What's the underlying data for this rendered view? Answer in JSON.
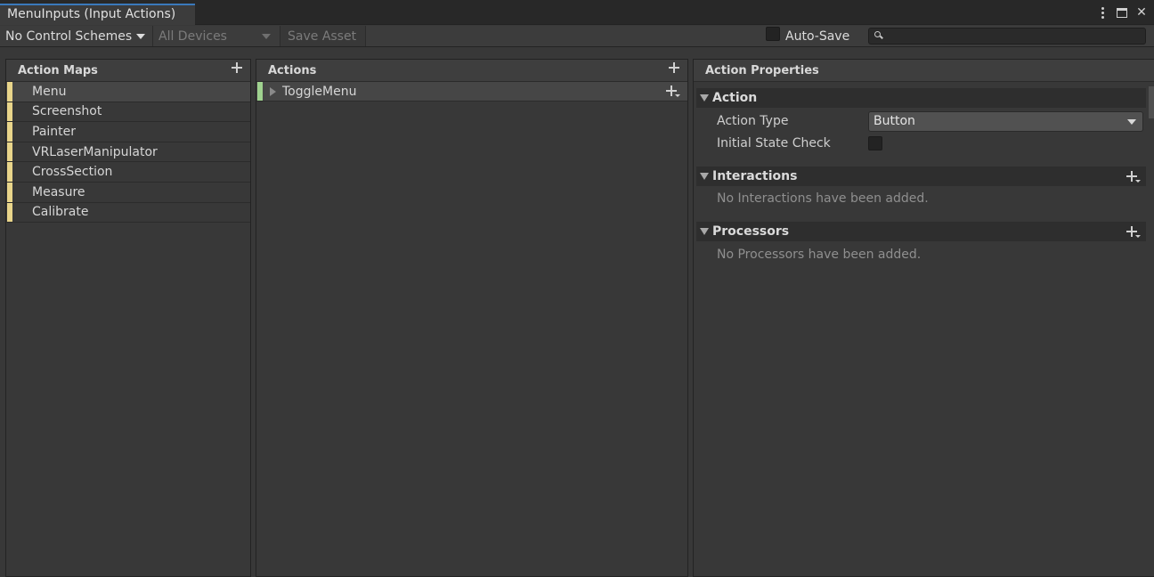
{
  "window": {
    "tab_title": "MenuInputs (Input Actions)"
  },
  "toolbar": {
    "control_schemes": "No Control Schemes",
    "devices": "All Devices",
    "save_asset": "Save Asset",
    "auto_save_label": "Auto-Save",
    "auto_save_checked": false,
    "search_value": ""
  },
  "action_maps": {
    "header": "Action Maps",
    "items": [
      {
        "label": "Menu",
        "selected": true
      },
      {
        "label": "Screenshot",
        "selected": false
      },
      {
        "label": "Painter",
        "selected": false
      },
      {
        "label": "VRLaserManipulator",
        "selected": false
      },
      {
        "label": "CrossSection",
        "selected": false
      },
      {
        "label": "Measure",
        "selected": false
      },
      {
        "label": "Calibrate",
        "selected": false
      }
    ]
  },
  "actions": {
    "header": "Actions",
    "items": [
      {
        "label": "ToggleMenu"
      }
    ]
  },
  "properties": {
    "header": "Action Properties",
    "action_section": "Action",
    "action_type_label": "Action Type",
    "action_type_value": "Button",
    "initial_state_label": "Initial State Check",
    "initial_state_checked": false,
    "interactions_section": "Interactions",
    "interactions_empty": "No Interactions have been added.",
    "processors_section": "Processors",
    "processors_empty": "No Processors have been added."
  },
  "colors": {
    "accent_tab": "#3a79bb",
    "action_map_marker": "#e9d58a",
    "action_marker": "#9fd28f"
  }
}
